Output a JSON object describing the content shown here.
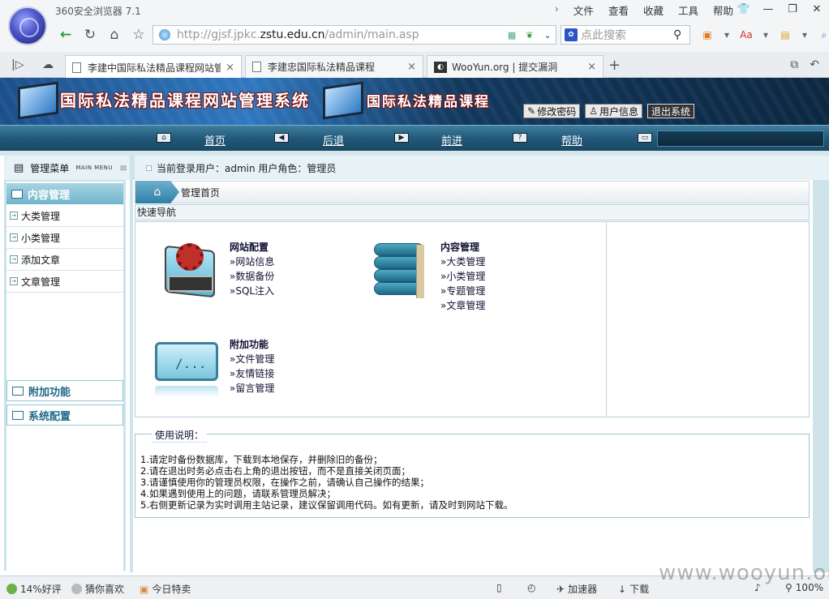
{
  "browser": {
    "title": "360安全浏览器 7.1",
    "menu": [
      "文件",
      "查看",
      "收藏",
      "工具",
      "帮助"
    ],
    "url_prefix": "http://gjsf.jpkc.",
    "url_host": "zstu.edu.cn",
    "url_path": "/admin/main.asp",
    "search_placeholder": "点此搜索",
    "tabs": [
      {
        "label": "李建中国际私法精品课程网站管"
      },
      {
        "label": "李建忠国际私法精品课程"
      },
      {
        "label": "WooYun.org | 提交漏洞"
      }
    ],
    "zoom": "100%"
  },
  "banner": {
    "title_main": "国际私法精品课程网站管理系统",
    "title_secondary": "国际私法精品课程",
    "buttons": {
      "change_password": "修改密码",
      "user_info": "用户信息",
      "logout": "退出系统"
    }
  },
  "navbar": {
    "home": "首页",
    "back": "后退",
    "forward": "前进",
    "help": "帮助"
  },
  "sidebar": {
    "title": "管理菜单",
    "title_en": "MAIN MENU",
    "group_content": "内容管理",
    "items": [
      "大类管理",
      "小类管理",
      "添加文章",
      "文章管理"
    ],
    "group_extra": "附加功能",
    "group_system": "系统配置"
  },
  "main": {
    "login_info": "当前登录用户：admin  用户角色：管理员",
    "breadcrumb": "管理首页",
    "quicknav_title": "快速导航",
    "groups": {
      "site_config": {
        "title": "网站配置",
        "links": [
          "»网站信息",
          "»数据备份",
          "»SQL注入"
        ]
      },
      "content": {
        "title": "内容管理",
        "links": [
          "»大类管理",
          "»小类管理",
          "»专题管理",
          "»文章管理"
        ]
      },
      "extra": {
        "title": "附加功能",
        "links": [
          "»文件管理",
          "»友情链接",
          "»留言管理"
        ]
      }
    },
    "usage_title": "使用说明：",
    "usage": [
      "1.请定时备份数据库，下载到本地保存，并删除旧的备份；",
      "2.请在退出时务必点击右上角的退出按钮，而不是直接关闭页面；",
      "3.请谨慎使用你的管理员权限，在操作之前，请确认自己操作的结果；",
      "4.如果遇到使用上的问题，请联系管理员解决；",
      "5.右侧更新记录为实时调用主站记录，建议保留调用代码。如有更新，请及时到网站下载。"
    ]
  },
  "statusbar": {
    "rating": "14%好评",
    "guess": "猜你喜欢",
    "deals": "今日特卖",
    "accelerator": "加速器",
    "download": "下载"
  },
  "watermark": "www.wooyun.org"
}
